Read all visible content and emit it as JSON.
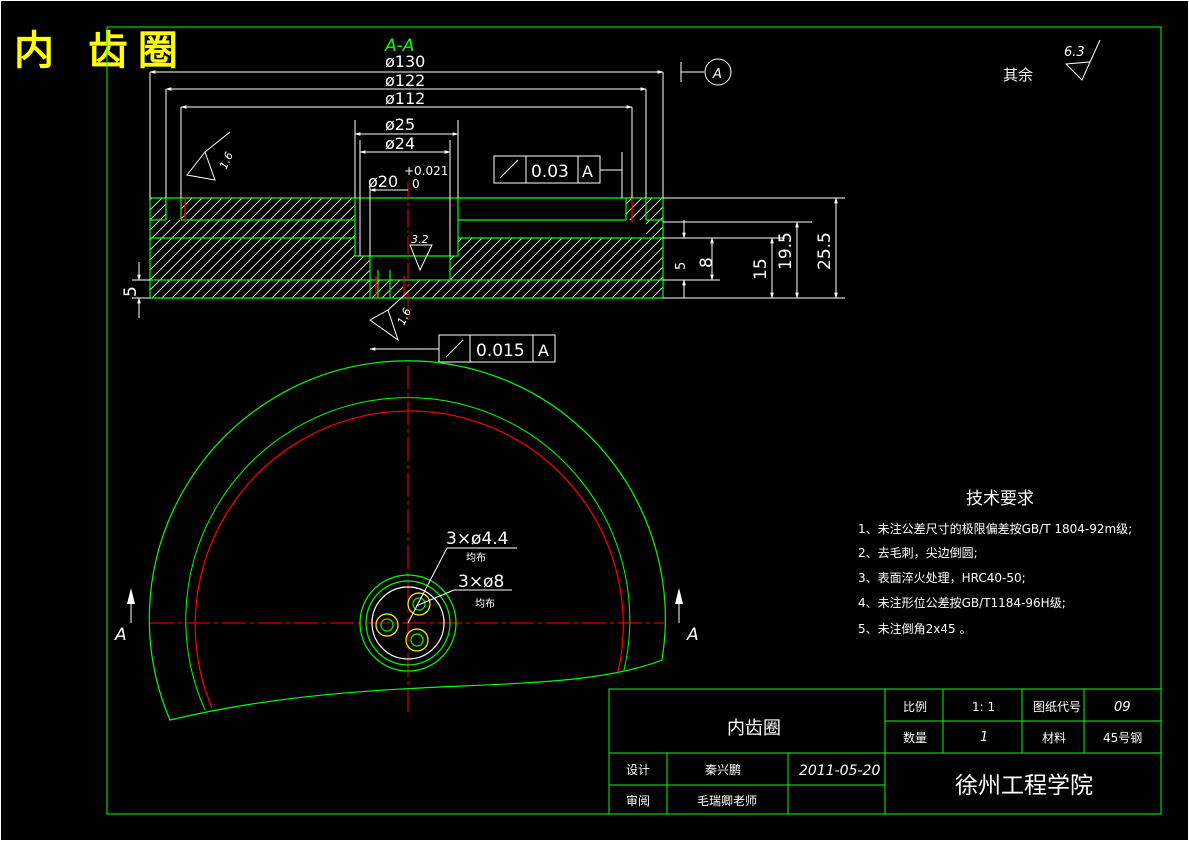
{
  "header": {
    "title": "内 齿圈"
  },
  "section": {
    "label": "A-A",
    "view_marker_left": "A",
    "view_marker_right": "A",
    "datum_letter": "A"
  },
  "dimensions": {
    "d130": "ø130",
    "d122": "ø122",
    "d112": "ø112",
    "d25": "ø25",
    "d24": "ø24",
    "d20": "ø20",
    "tol_upper": "+0.021",
    "tol_lower": "0",
    "h25_5": "25.5",
    "h19_5": "19.5",
    "h15": "15",
    "h8": "8",
    "h5": "5",
    "h5_right": "5"
  },
  "roughness": {
    "r16a": "1.6",
    "r16b": "1.6",
    "r32": "3.2",
    "r63": "6.3",
    "other_label": "其余"
  },
  "geom_tol": [
    {
      "symbol": "↗",
      "value": "0.03",
      "datum": "A"
    },
    {
      "symbol": "↗",
      "value": "0.015",
      "datum": "A"
    }
  ],
  "holes": {
    "small": "3×ø4.4",
    "small_note": "均布",
    "large": "3×ø8",
    "large_note": "均布"
  },
  "tech_req": {
    "title": "技术要求",
    "items": [
      "1、未注公差尺寸的极限偏差按GB/T 1804-92m级;",
      "2、去毛刺，尖边倒圆;",
      "3、表面淬火处理，HRC40-50;",
      "4、未注形位公差按GB/T1184-96H级;",
      "5、未注倒角2x45 。"
    ]
  },
  "title_block": {
    "part_name": "内齿圈",
    "scale_label": "比例",
    "scale_value": "1: 1",
    "drawing_no_label": "图纸代号",
    "drawing_no_value": "09",
    "qty_label": "数量",
    "qty_value": "1",
    "material_label": "材料",
    "material_value": "45号钢",
    "design_label": "设计",
    "designer": "秦兴鹏",
    "date": "2011-05-20",
    "review_label": "审阅",
    "reviewer": "毛瑞卿老师",
    "school": "徐州工程学院"
  },
  "colors": {
    "background": "#000000",
    "border": "#00ff00",
    "lines": "#ffffff",
    "center": "#ff0000",
    "title": "#ffff00",
    "section_label": "#00ff00"
  }
}
